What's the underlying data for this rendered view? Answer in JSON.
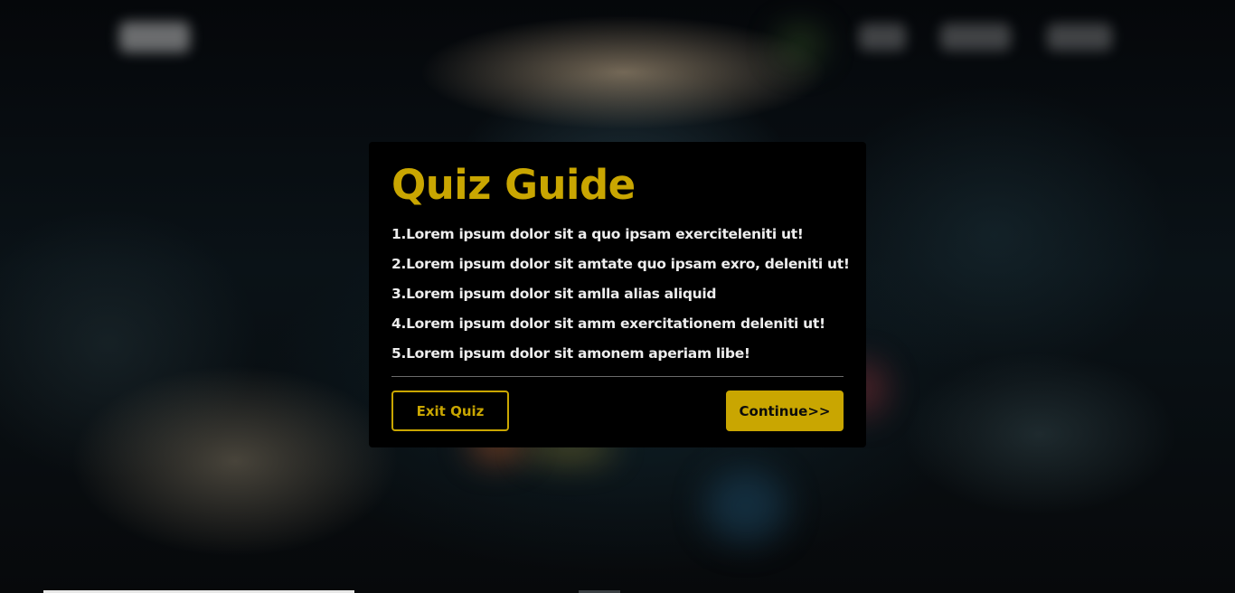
{
  "modal": {
    "title": "Quiz Guide",
    "rules": [
      "1.Lorem ipsum dolor sit a quo ipsam exerciteleniti ut!",
      "2.Lorem ipsum dolor sit amtate quo ipsam exro, deleniti ut!",
      "3.Lorem ipsum dolor sit amlla alias aliquid",
      "4.Lorem ipsum dolor sit amm exercitationem deleniti ut!",
      "5.Lorem ipsum dolor sit amonem aperiam libe!"
    ],
    "exit_label": "Exit Quiz",
    "continue_label": "Continue>>"
  },
  "colors": {
    "accent": "#c9a601",
    "modal_background": "#000000",
    "rule_text": "#eeeeee"
  }
}
